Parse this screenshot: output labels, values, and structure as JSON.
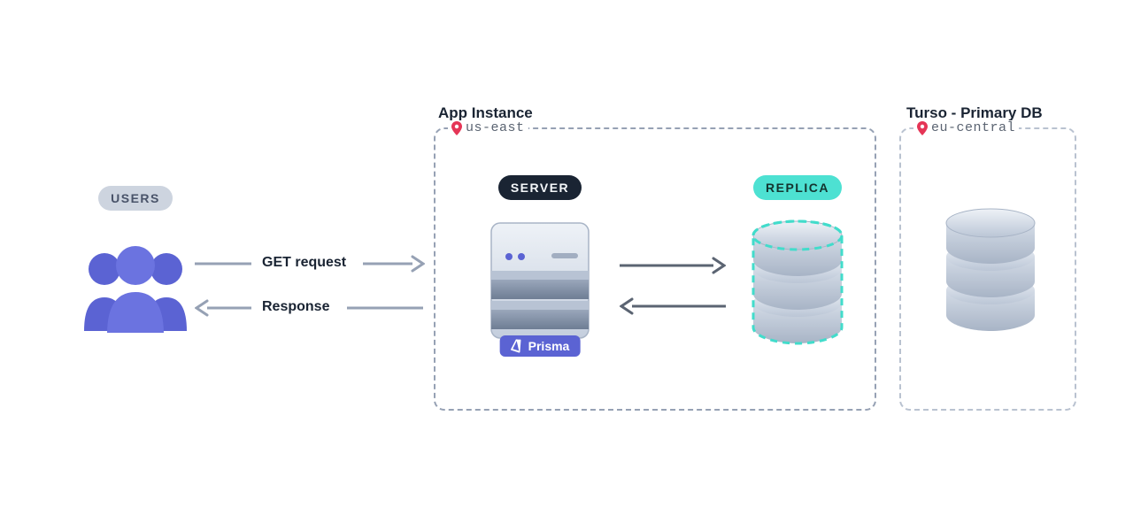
{
  "users": {
    "badge": "USERS"
  },
  "arrows": {
    "request": "GET request",
    "response": "Response"
  },
  "appInstance": {
    "title": "App Instance",
    "region": "us-east",
    "server": {
      "badge": "SERVER",
      "tag": "Prisma"
    },
    "replica": {
      "badge": "REPLICA"
    }
  },
  "primary": {
    "title": "Turso - Primary DB",
    "region": "eu-central"
  },
  "colors": {
    "accentPurple": "#5B63D3",
    "accentTeal": "#4DE1D2",
    "gray": "#96A1B4",
    "ink": "#1A2433",
    "pin": "#E53556"
  }
}
